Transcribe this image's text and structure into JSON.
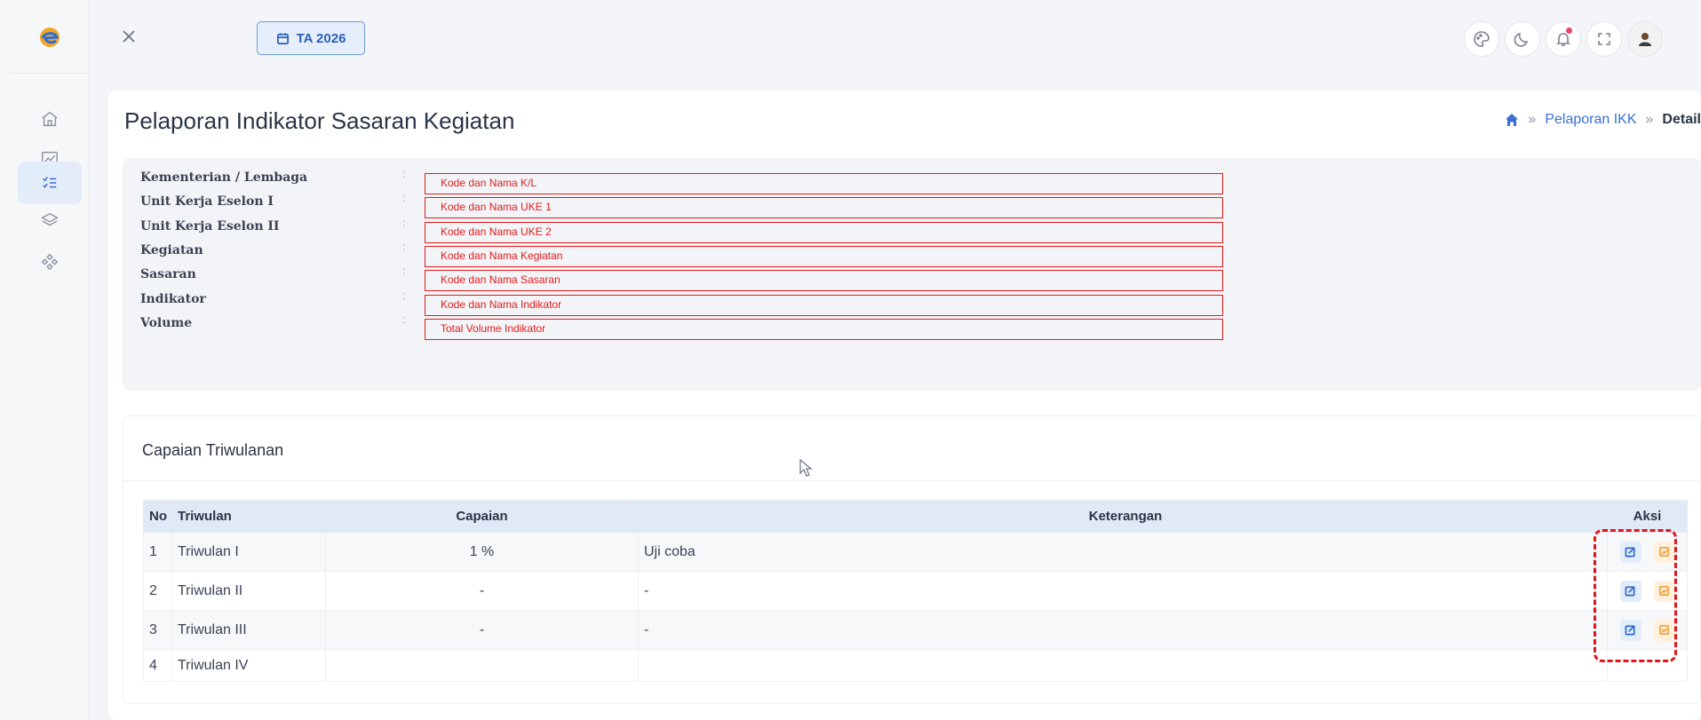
{
  "topbar": {
    "fiscal_year_label": "TA 2026"
  },
  "sidebar": {
    "items": [
      {
        "name": "home-icon"
      },
      {
        "name": "chart-icon"
      },
      {
        "name": "checklist-icon",
        "active": true
      },
      {
        "name": "layers-icon"
      },
      {
        "name": "components-icon"
      }
    ]
  },
  "page": {
    "title": "Pelaporan Indikator Sasaran Kegiatan",
    "breadcrumb": {
      "sep": "»",
      "link": "Pelaporan IKK",
      "current": "Detail"
    }
  },
  "info": {
    "colon": ":",
    "rows": [
      {
        "label": "Kementerian / Lembaga",
        "value": "Kode dan Nama K/L"
      },
      {
        "label": "Unit Kerja Eselon I",
        "value": "Kode dan Nama UKE 1"
      },
      {
        "label": "Unit Kerja Eselon II",
        "value": "Kode dan Nama UKE 2"
      },
      {
        "label": "Kegiatan",
        "value": "Kode dan Nama Kegiatan"
      },
      {
        "label": "Sasaran",
        "value": "Kode dan Nama Sasaran"
      },
      {
        "label": "Indikator",
        "value": "Kode dan Nama Indikator"
      },
      {
        "label": "Volume",
        "value": "Total Volume Indikator"
      }
    ]
  },
  "capaian": {
    "title": "Capaian Triwulanan",
    "headers": {
      "no": "No",
      "triwulan": "Triwulan",
      "capaian": "Capaian",
      "keterangan": "Keterangan",
      "aksi": "Aksi"
    },
    "rows": [
      {
        "no": "1",
        "triwulan": "Triwulan I",
        "capaian": "1 %",
        "keterangan": "Uji coba"
      },
      {
        "no": "2",
        "triwulan": "Triwulan II",
        "capaian": "-",
        "keterangan": "-"
      },
      {
        "no": "3",
        "triwulan": "Triwulan III",
        "capaian": "-",
        "keterangan": "-"
      },
      {
        "no": "4",
        "triwulan": "Triwulan IV",
        "capaian": "",
        "keterangan": ""
      }
    ]
  },
  "colors": {
    "accent": "#3a6fd0",
    "annotation_red": "#e21b1b",
    "edit_icon": "#2d68cf",
    "report_icon": "#f0a542"
  }
}
